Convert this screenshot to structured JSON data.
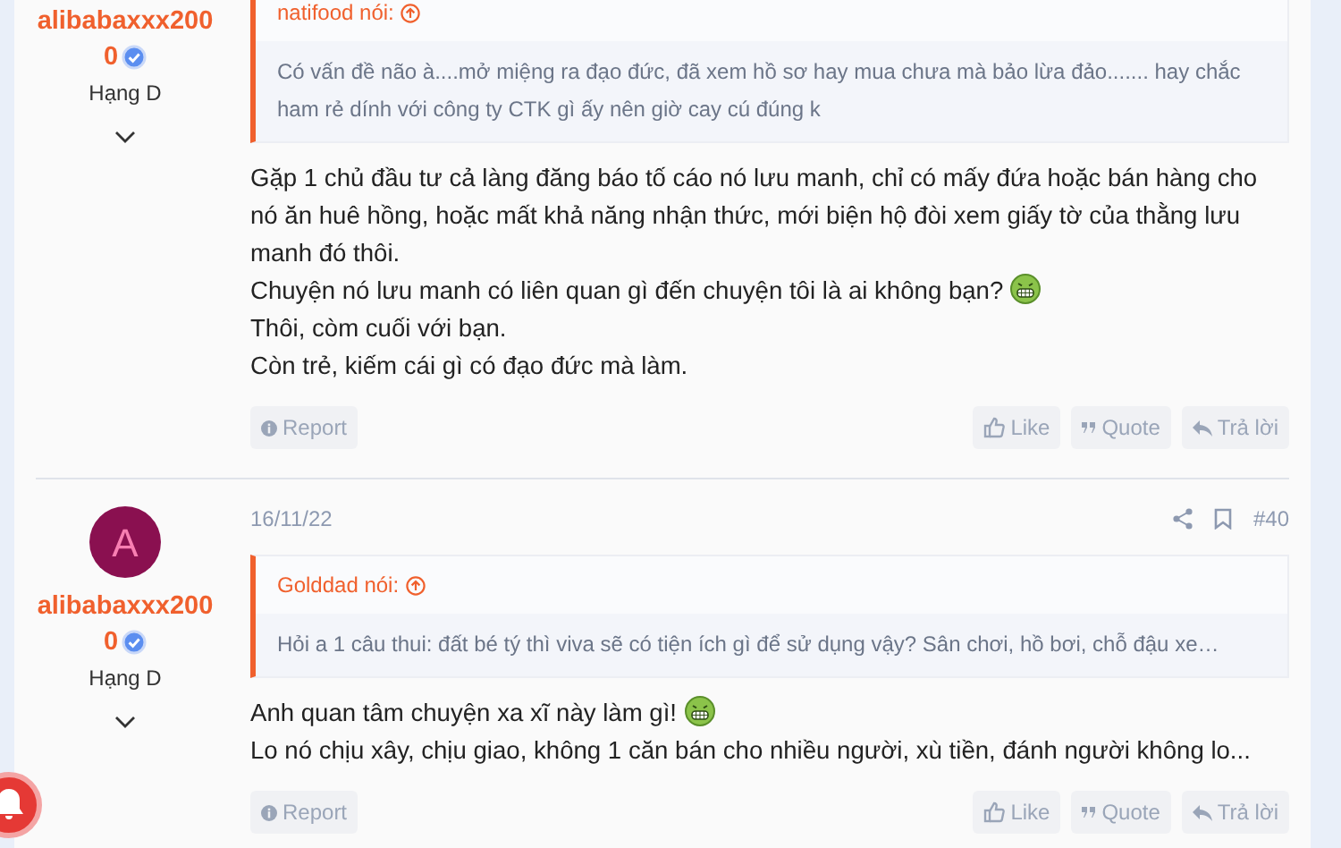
{
  "posts": [
    {
      "author": {
        "name_lines": [
          "alibabaxxx200",
          "0"
        ],
        "verified": true,
        "rank": "Hạng D"
      },
      "quote": {
        "source": "natifood nói:",
        "text": "Có vấn đề não à....mở miệng ra đạo đức, đã xem hồ sơ hay mua chưa mà bảo lừa đảo....... hay chắc ham rẻ dính với công ty CTK gì ấy nên giờ cay cú đúng k"
      },
      "body": [
        {
          "text": "Gặp 1 chủ đầu tư cả làng đăng báo tố cáo nó lưu manh, chỉ có mấy đứa hoặc bán hàng cho nó ăn huê hồng, hoặc mất khả năng nhận thức, mới biện hộ đòi xem giấy tờ của thằng lưu manh đó thôi.",
          "emoji": false
        },
        {
          "text": "Chuyện nó lưu manh có liên quan gì đến chuyện tôi là ai không bạn?",
          "emoji": true
        },
        {
          "text": "Thôi, còm cuối với bạn.",
          "emoji": false
        },
        {
          "text": "Còn trẻ, kiếm cái gì có đạo đức mà làm.",
          "emoji": false
        }
      ],
      "actions": [
        "Report",
        "Like",
        "Quote",
        "Trả lời"
      ]
    },
    {
      "author": {
        "avatar": "A",
        "name_lines": [
          "alibabaxxx200",
          "0"
        ],
        "verified": true,
        "rank": "Hạng D"
      },
      "date": "16/11/22",
      "number": "#40",
      "quote": {
        "source": "Golddad nói:",
        "text": "Hỏi a 1 câu thui: đất bé tý thì viva sẽ có tiện ích gì để sử dụng vậy? Sân chơi, hồ bơi, chỗ đậu xe…"
      },
      "body": [
        {
          "text": "Anh quan tâm chuyện xa xĩ này làm gì!",
          "emoji": true
        },
        {
          "text": "Lo nó chịu xây, chịu giao, không 1 căn bán cho nhiều người, xù tiền, đánh người không lo...",
          "emoji": false
        }
      ],
      "actions": [
        "Report",
        "Like",
        "Quote",
        "Trả lời"
      ]
    }
  ]
}
